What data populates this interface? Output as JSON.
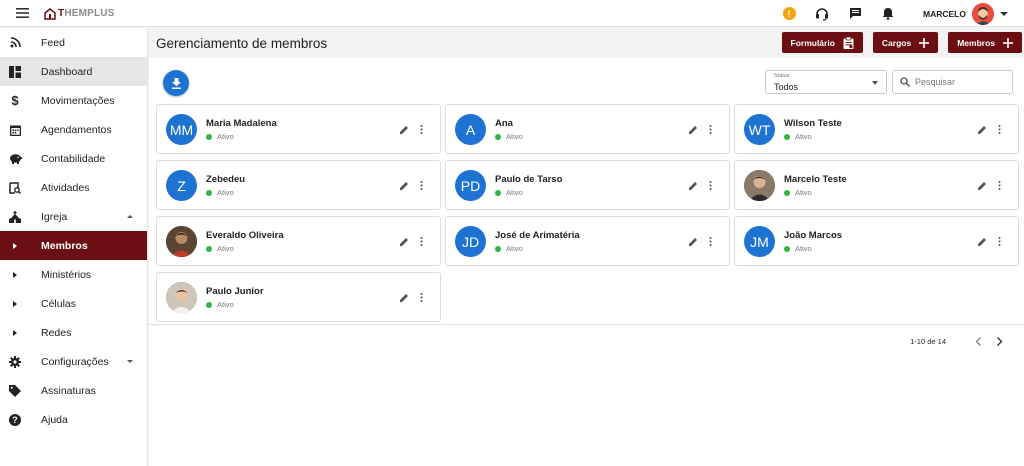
{
  "app": {
    "logo_letter": "T",
    "logo_rest": "HEMPLUS"
  },
  "topbar": {
    "info_badge": "!",
    "user_name": "MARCELO"
  },
  "sidebar": {
    "items": [
      {
        "label": "Feed"
      },
      {
        "label": "Dashboard"
      },
      {
        "label": "Movimentações"
      },
      {
        "label": "Agendamentos"
      },
      {
        "label": "Contabilidade"
      },
      {
        "label": "Atividades"
      },
      {
        "label": "Igreja"
      },
      {
        "label": "Membros"
      },
      {
        "label": "Ministérios"
      },
      {
        "label": "Células"
      },
      {
        "label": "Redes"
      },
      {
        "label": "Configurações"
      },
      {
        "label": "Assinaturas"
      },
      {
        "label": "Ajuda"
      }
    ]
  },
  "header": {
    "title": "Gerenciamento de membros",
    "buttons": {
      "formulario": "Formulário",
      "cargos": "Cargos",
      "membros": "Membros"
    }
  },
  "filters": {
    "status_label": "Status",
    "status_value": "Todos",
    "search_placeholder": "Pesquisar"
  },
  "members": [
    {
      "name": "Maria Madalena",
      "initials": "MM",
      "status": "Ativo"
    },
    {
      "name": "Ana",
      "initials": "A",
      "status": "Ativo"
    },
    {
      "name": "Wilson Teste",
      "initials": "WT",
      "status": "Ativo"
    },
    {
      "name": "Zebedeu",
      "initials": "Z",
      "status": "Ativo"
    },
    {
      "name": "Paulo de Tarso",
      "initials": "PD",
      "status": "Ativo"
    },
    {
      "name": "Marcelo Teste",
      "initials": "",
      "status": "Ativo"
    },
    {
      "name": "Everaldo Oliveira",
      "initials": "",
      "status": "Ativo"
    },
    {
      "name": "José de Arimatéria",
      "initials": "JD",
      "status": "Ativo"
    },
    {
      "name": "João Marcos",
      "initials": "JM",
      "status": "Ativo"
    },
    {
      "name": "Paulo Junior",
      "initials": "",
      "status": "Ativo"
    }
  ],
  "pagination": {
    "range_text": "1-10 de 14"
  },
  "colors": {
    "brand": "#6b0f12",
    "avatar_blue": "#1e73d2",
    "active_green": "#2fb34a",
    "info_orange": "#f5a30a"
  }
}
